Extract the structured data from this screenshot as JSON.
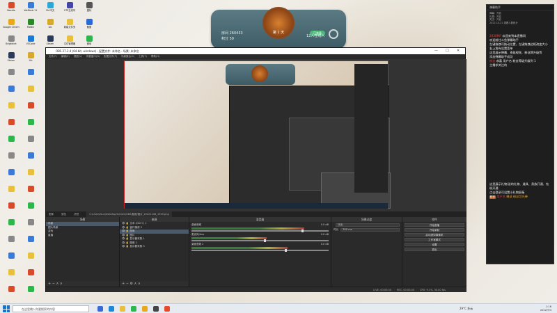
{
  "desktop": {
    "icons": [
      {
        "label": "Neeldo",
        "color": "#d84a2a"
      },
      {
        "label": "WeMeds 11",
        "color": "#3a7ad8"
      },
      {
        "label": "Ctrl中文",
        "color": "#2aa8d8"
      },
      {
        "label": "UTE主线号",
        "color": "#4444aa"
      },
      {
        "label": "图标",
        "color": "#555555"
      },
      {
        "label": "Google Chrome",
        "color": "#e8a81a"
      },
      {
        "label": "MoBin",
        "color": "#2a8a2a"
      },
      {
        "label": "Lib",
        "color": "#d8a82a"
      },
      {
        "label": "新建文件夹",
        "color": "#e8c03a"
      },
      {
        "label": "截图",
        "color": "#2a6ad8"
      },
      {
        "label": "Brightnet",
        "color": "#888888"
      },
      {
        "label": "VSCode",
        "color": "#1a7ad8"
      },
      {
        "label": "Steam",
        "color": "#2a3a5a"
      },
      {
        "label": "文件管理器",
        "color": "#e8c03a"
      },
      {
        "label": "微信",
        "color": "#2ab84a"
      },
      {
        "label": "Steam",
        "color": "#2a3a5a"
      },
      {
        "label": "Lib",
        "color": "#d8a82a"
      },
      {
        "label": "360",
        "color": "#2a9ad8"
      },
      {
        "label": "百度网盘",
        "color": "#2a8ad8"
      },
      {
        "label": "Office",
        "color": "#d84a2a"
      }
    ]
  },
  "widget": {
    "players": "房间 260433",
    "score": "积分 59",
    "rank_label": "第 1 天",
    "online": "12人在线人",
    "join_btn": "已准备"
  },
  "obs": {
    "title": "OBS 27.2.4 (64-bit, windows) - 配置文件: 未命名 - 场景: 未命名",
    "menu": [
      "文件(F)",
      "编辑(E)",
      "视图(V)",
      "停靠窗口(D)",
      "配置文件(P)",
      "场景集合(S)",
      "工具(T)",
      "帮助(H)"
    ],
    "strip": {
      "label": "图像",
      "attrs": "属性",
      "filters": "滤镜",
      "path": "C:/Users/Sun/Desktop/Games/OBS/截图/图片_20221108_1935.png"
    },
    "scenes": {
      "title": "场景",
      "items": [
        "场景",
        "图片场景",
        "游戏",
        "直播"
      ],
      "selected": 0
    },
    "sources": {
      "title": "来源",
      "items": [
        "文本 (GDI+) 1",
        "窗口捕获 2",
        "图像",
        "图片",
        "显示器采集 1",
        "图像 2",
        "显示器采集 3"
      ],
      "selected": 2
    },
    "mixer": {
      "title": "混音器",
      "channels": [
        {
          "name": "桌面音频",
          "db": "0.0 dB",
          "level": 0.82
        },
        {
          "name": "麦克风/Aux",
          "db": "0.0 dB",
          "level": 0.55
        },
        {
          "name": "桌面音频 2",
          "db": "0.0 dB",
          "level": 0.7
        }
      ]
    },
    "transitions": {
      "title": "场景过渡",
      "type": "淡出",
      "duration_label": "时长",
      "duration": "300 ms"
    },
    "controls": {
      "title": "控件",
      "buttons": [
        "开始直播",
        "开始录制",
        "启动虚拟摄像机",
        "工作室模式",
        "设置",
        "退出"
      ]
    },
    "status": [
      "LIVE: 00:00:00",
      "REC: 00:00:00",
      "CPU: 9.1%, 30.00 fps"
    ]
  },
  "chat": {
    "title": "弹幕助手",
    "top_lines": [
      "弹幕：开启",
      "礼物：开启",
      "关注：开启",
      "2022.10.21 观看人数统计"
    ],
    "messages": [
      {
        "user": "2838MR",
        "text": "欢迎来到本直播间"
      },
      {
        "user": "",
        "text": "欢迎前往斗鱼弹幕助手"
      },
      {
        "user": "",
        "text": "左键拖拽可拖动位置，左键拖拽边框改变大小"
      },
      {
        "user": "",
        "text": "右上角有设置菜单"
      },
      {
        "user": "",
        "text": "这里展示弹幕、贵族视效、粉丝牌升级等"
      },
      {
        "user": "",
        "text": "添加弹幕助手成功"
      },
      {
        "user": "粉丝",
        "text": "恭喜 用户名 粉丝等级升级到 1"
      },
      {
        "user": "",
        "text": "主播求关注的"
      }
    ],
    "lower": [
      {
        "text": "这里展示礼物/送的礼物、道具、贵族开通、钻粉开通"
      },
      {
        "text": "点击登录可设置小礼物屏蔽"
      }
    ],
    "gift_line": {
      "badge": "粉丝",
      "user": "用户名",
      "action": "赠送 粉丝荧光棒"
    }
  },
  "taskbar": {
    "search_placeholder": "在这里输入你要搜索的内容",
    "weather": "29°C 多云",
    "time": "1:16",
    "date": "2022/9/3"
  }
}
